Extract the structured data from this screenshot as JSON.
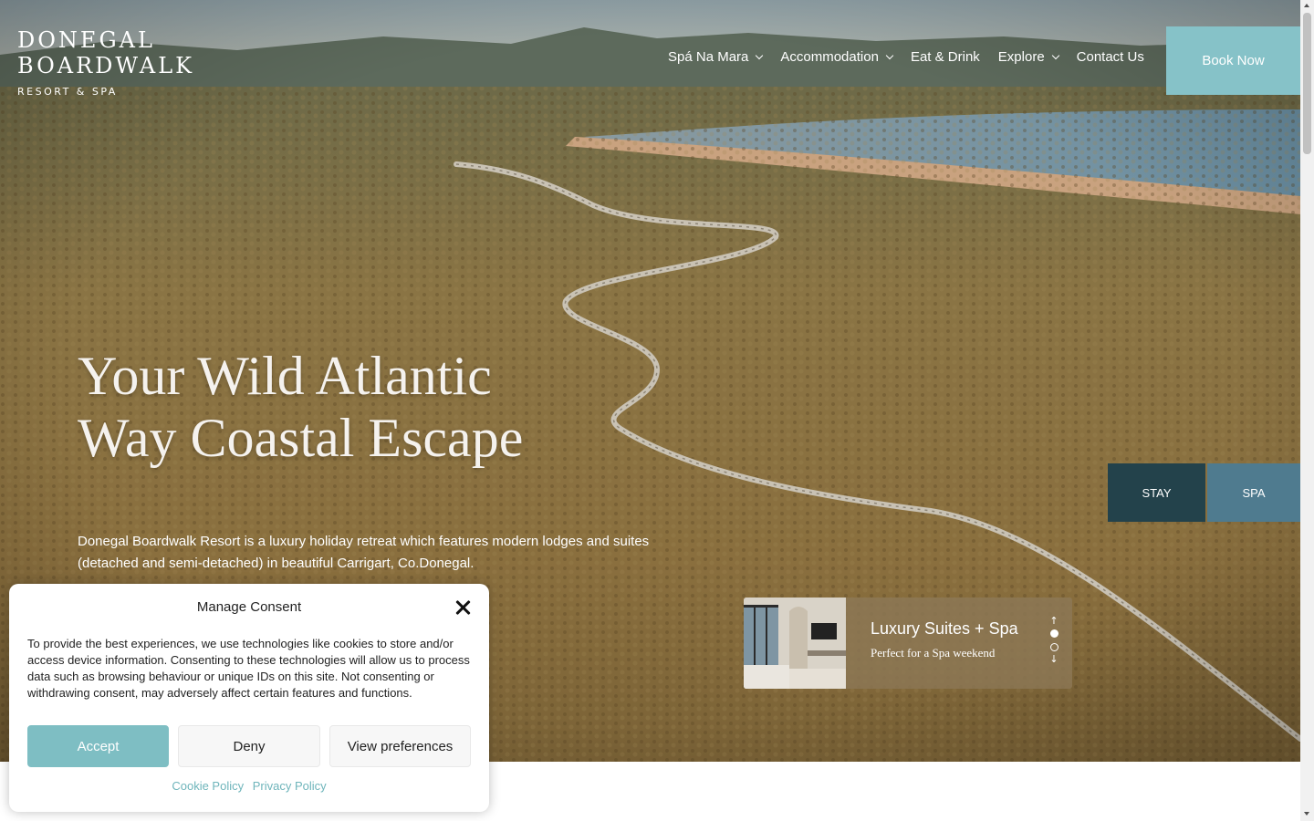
{
  "logo": {
    "line1": "DONEGAL",
    "line2": "BOARDWALK",
    "line3": "RESORT & SPA"
  },
  "nav": {
    "items": [
      {
        "label": "Spá Na Mara",
        "dropdown": true
      },
      {
        "label": "Accommodation",
        "dropdown": true
      },
      {
        "label": "Eat & Drink",
        "dropdown": false
      },
      {
        "label": "Explore",
        "dropdown": true
      },
      {
        "label": "Contact Us",
        "dropdown": false
      }
    ],
    "book_now": "Book Now"
  },
  "hero": {
    "headline_line1": "Your Wild Atlantic",
    "headline_line2": "Way Coastal Escape",
    "intro": "Donegal Boardwalk Resort is a luxury holiday retreat which features modern lodges and suites (detached and semi-detached) in beautiful Carrigart, Co.Donegal."
  },
  "side_buttons": {
    "stay": "STAY",
    "spa": "SPA"
  },
  "slider_card": {
    "title": "Luxury Suites + Spa",
    "subtitle": "Perfect for a Spa weekend",
    "up_arrow": "↑",
    "down_arrow": "↓",
    "active_dot": 0,
    "dot_count": 2
  },
  "consent": {
    "title": "Manage Consent",
    "text": "To provide the best experiences, we use technologies like cookies to store and/or access device information. Consenting to these technologies will allow us to process data such as browsing behaviour or unique IDs on this site. Not consenting or withdrawing consent, may adversely affect certain features and functions.",
    "accept": "Accept",
    "deny": "Deny",
    "view_preferences": "View preferences",
    "cookie_policy": "Cookie Policy",
    "privacy_policy": "Privacy Policy"
  },
  "colors": {
    "book_now_bg": "#86c2c8",
    "stay_bg": "#23424b",
    "spa_bg": "#4f7b8f",
    "accept_bg": "#7ebec3",
    "link": "#6fb5bb"
  }
}
